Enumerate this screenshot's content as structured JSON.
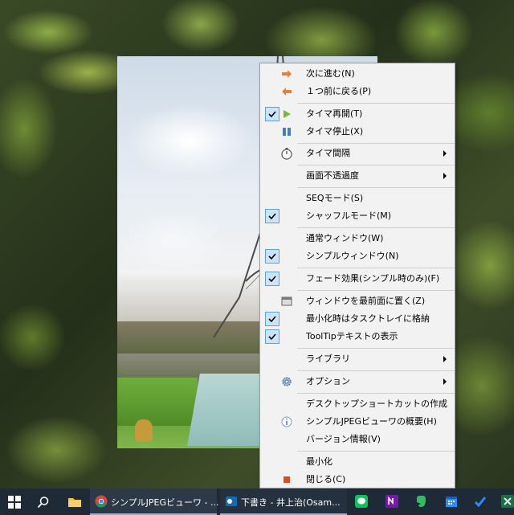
{
  "menu": {
    "items": [
      {
        "label": "次に進む(N)",
        "checked": false,
        "icon": "arrow-right-icon"
      },
      {
        "label": "１つ前に戻る(P)",
        "checked": false,
        "icon": "arrow-left-icon"
      },
      {
        "label": "タイマ再開(T)",
        "checked": true,
        "icon": "play-icon"
      },
      {
        "label": "タイマ停止(X)",
        "checked": false,
        "icon": "pause-icon"
      },
      {
        "label": "タイマ間隔",
        "checked": false,
        "icon": "stopwatch-icon",
        "submenu": true
      },
      {
        "label": "画面不透過度",
        "checked": false,
        "submenu": true
      },
      {
        "label": "SEQモード(S)",
        "checked": false
      },
      {
        "label": "シャッフルモード(M)",
        "checked": true
      },
      {
        "label": "通常ウィンドウ(W)",
        "checked": false
      },
      {
        "label": "シンプルウィンドウ(N)",
        "checked": true
      },
      {
        "label": "フェード効果(シンプル時のみ)(F)",
        "checked": true
      },
      {
        "label": "ウィンドウを最前面に置く(Z)",
        "checked": false,
        "icon": "window-topmost-icon"
      },
      {
        "label": "最小化時はタスクトレイに格納",
        "checked": true
      },
      {
        "label": "ToolTipテキストの表示",
        "checked": true
      },
      {
        "label": "ライブラリ",
        "checked": false,
        "submenu": true
      },
      {
        "label": "オプション",
        "checked": false,
        "icon": "gear-icon",
        "submenu": true
      },
      {
        "label": "デスクトップショートカットの作成",
        "checked": false
      },
      {
        "label": "シンプルJPEGビューワの概要(H)",
        "checked": false,
        "icon": "info-icon"
      },
      {
        "label": "バージョン情報(V)",
        "checked": false
      },
      {
        "label": "最小化",
        "checked": false
      },
      {
        "label": "閉じる(C)",
        "checked": false,
        "icon": "close-square-icon"
      }
    ]
  },
  "taskbar": {
    "apps": [
      {
        "label": "シンプルJPEGビューワ - ...",
        "icon": "chrome-icon"
      },
      {
        "label": "下書き - 井上治(Osam...",
        "icon": "outlook-icon"
      }
    ]
  },
  "colors": {
    "menu_bg": "#f2f2f2",
    "check_bg": "#cce4f7",
    "check_border": "#5ea0d8",
    "taskbar_bg": "#1f2a37",
    "accent": "#76b9ed"
  }
}
